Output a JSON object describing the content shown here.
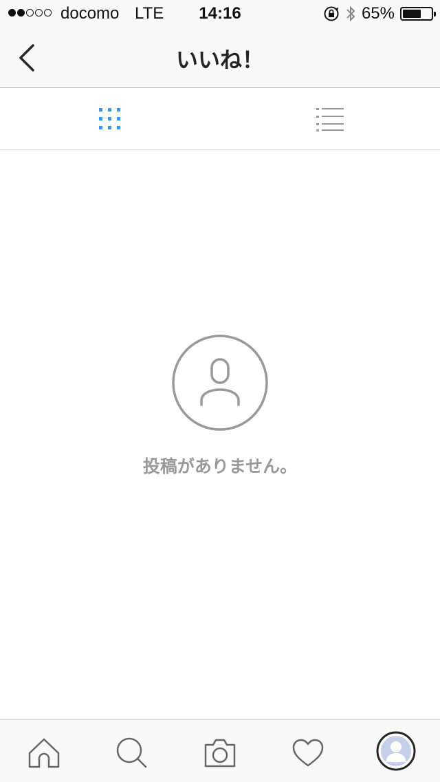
{
  "status_bar": {
    "carrier": "docomo",
    "network": "LTE",
    "time": "14:16",
    "battery_percent": "65%",
    "battery_level": 0.65,
    "signal_bars_filled": 2,
    "signal_bars_total": 5
  },
  "nav": {
    "title": "いいね！",
    "back_icon": "chevron-left-icon"
  },
  "view_toggle": {
    "active": "grid",
    "active_color": "#3897f0",
    "inactive_color": "#999999"
  },
  "empty_state": {
    "icon": "person-circle-icon",
    "message": "投稿がありません。"
  },
  "tab_bar": {
    "items": [
      {
        "icon": "home-icon"
      },
      {
        "icon": "search-icon"
      },
      {
        "icon": "camera-icon"
      },
      {
        "icon": "heart-icon"
      },
      {
        "icon": "profile-avatar-icon"
      }
    ]
  }
}
